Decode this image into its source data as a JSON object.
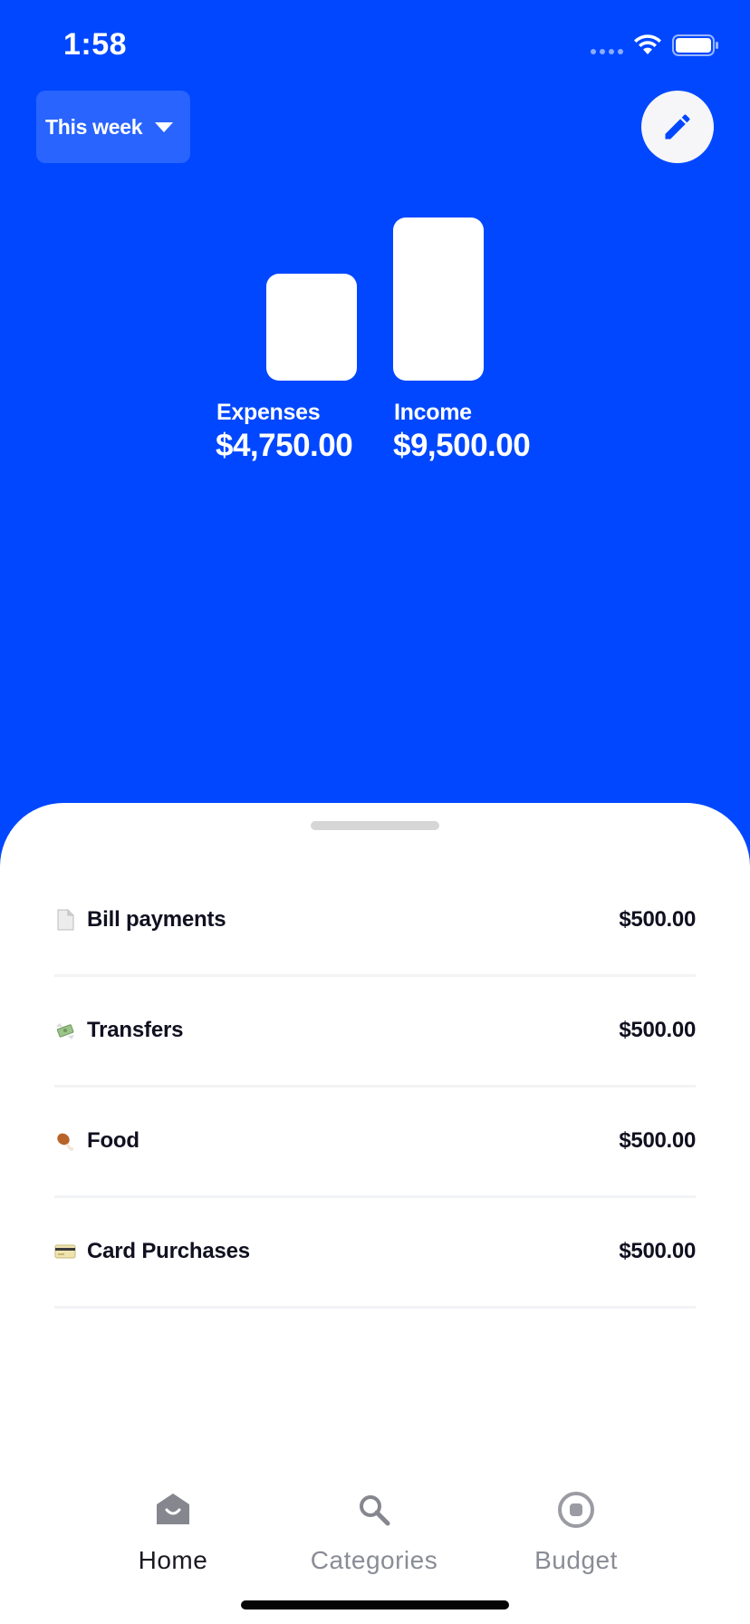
{
  "status_bar": {
    "time": "1:58"
  },
  "header": {
    "period_selector": "This week",
    "edit_icon": "pencil-icon"
  },
  "summary": {
    "expenses": {
      "label": "Expenses",
      "amount": "$4,750.00",
      "value": 4750
    },
    "income": {
      "label": "Income",
      "amount": "$9,500.00",
      "value": 9500
    }
  },
  "categories": [
    {
      "emoji": "page-facing-up-icon",
      "name": "Bill payments",
      "amount": "$500.00"
    },
    {
      "emoji": "money-with-wings-icon",
      "name": "Transfers",
      "amount": "$500.00"
    },
    {
      "emoji": "poultry-leg-icon",
      "name": "Food",
      "amount": "$500.00"
    },
    {
      "emoji": "credit-card-icon",
      "name": "Card Purchases",
      "amount": "$500.00"
    }
  ],
  "tab_bar": {
    "tabs": [
      {
        "label": "Home",
        "icon": "home-icon",
        "active": true
      },
      {
        "label": "Categories",
        "icon": "search-icon",
        "active": false
      },
      {
        "label": "Budget",
        "icon": "budget-icon",
        "active": false
      }
    ]
  },
  "colors": {
    "background": "#0047FF",
    "sheet": "#FFFFFF",
    "text_dark": "#101020",
    "tab_inactive": "#8A8C96"
  }
}
